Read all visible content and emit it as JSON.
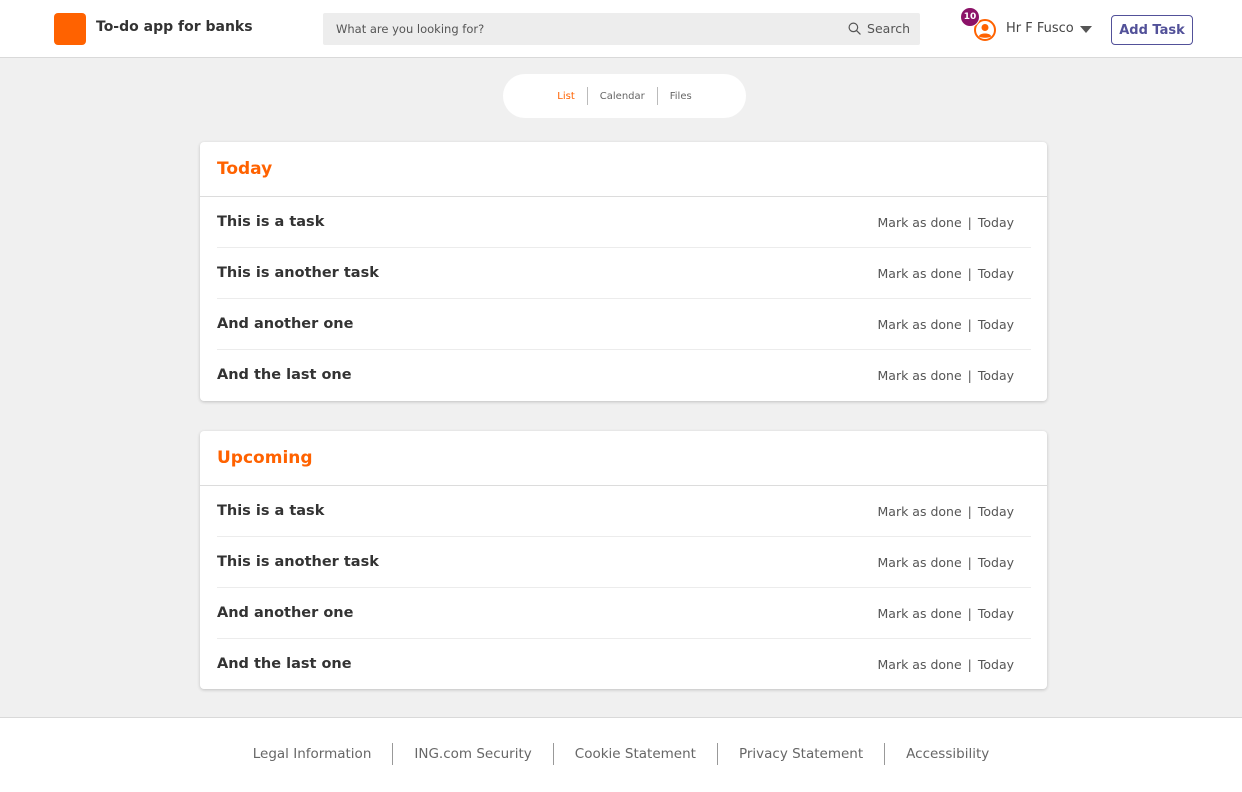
{
  "header": {
    "app_title": "To-do app for banks",
    "search": {
      "placeholder": "What are you looking for?",
      "button_label": "Search",
      "icon": "search-icon"
    },
    "user": {
      "notification_count": "10",
      "name": "Hr F Fusco",
      "icon": "user-icon"
    },
    "add_task_label": "Add Task"
  },
  "view_tabs": [
    {
      "label": "List",
      "active": true
    },
    {
      "label": "Calendar",
      "active": false
    },
    {
      "label": "Files",
      "active": false
    }
  ],
  "sections": [
    {
      "title": "Today",
      "tasks": [
        {
          "title": "This is a task",
          "action": "Mark as done",
          "separator": "|",
          "due": "Today"
        },
        {
          "title": "This is another task",
          "action": "Mark as done",
          "separator": "|",
          "due": "Today"
        },
        {
          "title": "And another one",
          "action": "Mark as done",
          "separator": "|",
          "due": "Today"
        },
        {
          "title": "And the last one",
          "action": "Mark as done",
          "separator": "|",
          "due": "Today"
        }
      ]
    },
    {
      "title": "Upcoming",
      "tasks": [
        {
          "title": "This is a task",
          "action": "Mark as done",
          "separator": "|",
          "due": "Today"
        },
        {
          "title": "This is another task",
          "action": "Mark as done",
          "separator": "|",
          "due": "Today"
        },
        {
          "title": "And another one",
          "action": "Mark as done",
          "separator": "|",
          "due": "Today"
        },
        {
          "title": "And the last one",
          "action": "Mark as done",
          "separator": "|",
          "due": "Today"
        }
      ]
    }
  ],
  "footer": {
    "links": [
      "Legal Information",
      "ING.com Security",
      "Cookie Statement",
      "Privacy Statement",
      "Accessibility"
    ]
  },
  "colors": {
    "brand_orange": "#ff6200",
    "accent_indigo": "#525199",
    "badge_purple": "#8b1268",
    "background": "#f0f0f0"
  }
}
